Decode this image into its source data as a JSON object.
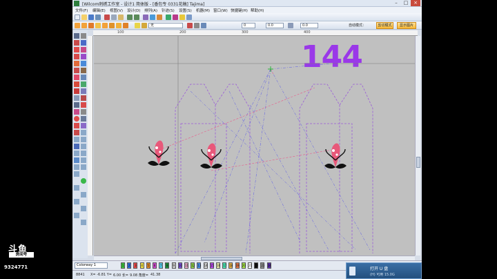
{
  "window": {
    "title": "[Wilcom刺绣工作室 - 设计1 简体版 - [香包专 0331花稿]      Tajima]"
  },
  "menu": [
    "文件(F)",
    "编辑(E)",
    "视图(V)",
    "设计(D)",
    "排列(A)",
    "针迹(S)",
    "设置(S)",
    "机器(M)",
    "窗口(W)",
    "快捷键(H)",
    "帮助(H)"
  ],
  "toolbar3": {
    "fabric": "无",
    "zoom_value": "0.0",
    "mode_label": "自动模式：",
    "btn_reset": "剪切模式",
    "btn_show": "显示图片"
  },
  "ruler_ticks": [
    "100",
    "200",
    "300",
    "400"
  ],
  "canvas": {
    "big_number": "144",
    "bg_color": "#c0c0c0",
    "accent_purple": "#9a38e8"
  },
  "palette": {
    "colorway": "Colorway 1",
    "swatches": [
      {
        "n": "1",
        "color": "#3cc43c"
      },
      {
        "n": "2",
        "color": "#2f6fdc"
      },
      {
        "n": "3",
        "color": "#e64a4a"
      },
      {
        "n": "4",
        "color": "#f0e24a"
      },
      {
        "n": "5",
        "color": "#e08a2c"
      },
      {
        "n": "6",
        "color": "#d14ad1"
      },
      {
        "n": "7",
        "color": "#55c8e6"
      },
      {
        "n": "8",
        "color": "#1e8f3b"
      },
      {
        "n": "9",
        "color": "#c8c8c8"
      },
      {
        "n": "10",
        "color": "#7a4fd6"
      },
      {
        "n": "11",
        "color": "#e6a8c8"
      },
      {
        "n": "12",
        "color": "#8fd14a"
      },
      {
        "n": "13",
        "color": "#4a8fe6"
      },
      {
        "n": "14",
        "color": "#d6d6d6"
      },
      {
        "n": "15",
        "color": "#b44ae6"
      },
      {
        "n": "16",
        "color": "#e6e6a8"
      },
      {
        "n": "17",
        "color": "#4ae6b4"
      },
      {
        "n": "18",
        "color": "#e6b44a"
      },
      {
        "n": "19",
        "color": "#e67a4a"
      },
      {
        "n": "20",
        "color": "#a8e64a"
      },
      {
        "n": "21",
        "color": "#ffffff"
      },
      {
        "n": "22",
        "color": "#111111"
      },
      {
        "n": "23",
        "color": "#8a8a8a"
      },
      {
        "n": "24",
        "color": "#5a2fa8"
      }
    ]
  },
  "status": {
    "stitches": "8841",
    "x": "X= -6.81 Y=",
    "y": "6.00 长=",
    "len": "9.08 角度=",
    "angle": "41.38"
  },
  "usb_notice": {
    "title": "打开 U 盘",
    "sub": "(H) 可用 15.0G"
  },
  "overlay": {
    "brand": "斗鱼",
    "room_label": "房间号",
    "room_number": "9324771"
  }
}
